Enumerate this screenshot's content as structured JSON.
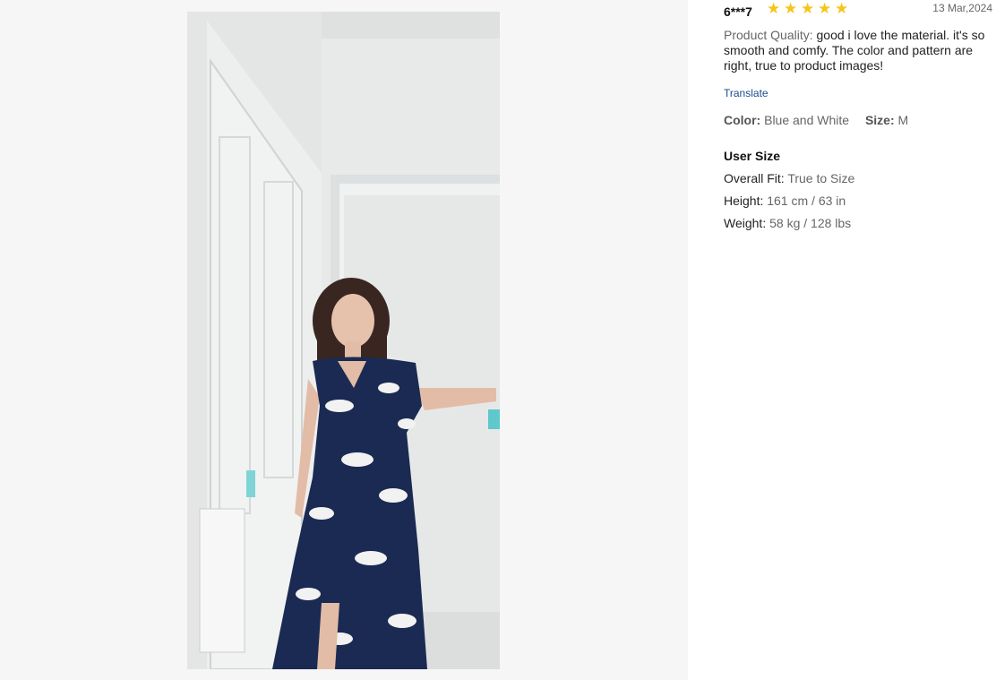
{
  "review": {
    "user": "6***7",
    "rating": 5,
    "date": "13 Mar,2024",
    "quality_label": "Product Quality:",
    "quality_text": "good i love the material. it's so smooth and comfy. The color and pattern are right, true to product images!",
    "translate": "Translate",
    "color_label": "Color:",
    "color_value": "Blue and White",
    "size_label": "Size:",
    "size_value": "M"
  },
  "user_size": {
    "title": "User Size",
    "fit_label": "Overall Fit:",
    "fit_value": "True to Size",
    "height_label": "Height:",
    "height_value": "161 cm / 63 in",
    "weight_label": "Weight:",
    "weight_value": "58 kg / 128 lbs"
  },
  "colors": {
    "star": "#f5c518",
    "link": "#1a4c8c"
  }
}
